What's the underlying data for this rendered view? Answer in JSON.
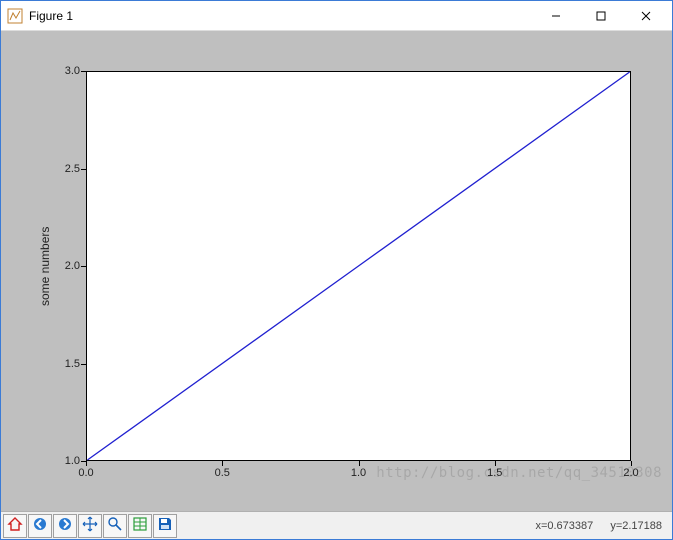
{
  "window": {
    "title": "Figure 1",
    "controls": {
      "minimize": "minimize",
      "maximize": "maximize",
      "close": "close"
    }
  },
  "chart_data": {
    "type": "line",
    "x": [
      0.0,
      1.0,
      2.0
    ],
    "y": [
      1.0,
      2.0,
      3.0
    ],
    "title": "",
    "xlabel": "",
    "ylabel": "some numbers",
    "xlim": [
      0.0,
      2.0
    ],
    "ylim": [
      1.0,
      3.0
    ],
    "xticks": [
      "0.0",
      "0.5",
      "1.0",
      "1.5",
      "2.0"
    ],
    "yticks": [
      "1.0",
      "1.5",
      "2.0",
      "2.5",
      "3.0"
    ],
    "line_color": "#2020d0"
  },
  "toolbar": {
    "items": [
      {
        "name": "home-icon",
        "label": "Home"
      },
      {
        "name": "back-icon",
        "label": "Back"
      },
      {
        "name": "forward-icon",
        "label": "Forward"
      },
      {
        "name": "pan-icon",
        "label": "Pan"
      },
      {
        "name": "zoom-icon",
        "label": "Zoom"
      },
      {
        "name": "subplot-icon",
        "label": "Configure subplots"
      },
      {
        "name": "save-icon",
        "label": "Save"
      }
    ]
  },
  "status": {
    "x_label": "x=0.673387",
    "y_label": "y=2.17188"
  },
  "watermark": "http://blog.csdn.net/qq_34510308"
}
